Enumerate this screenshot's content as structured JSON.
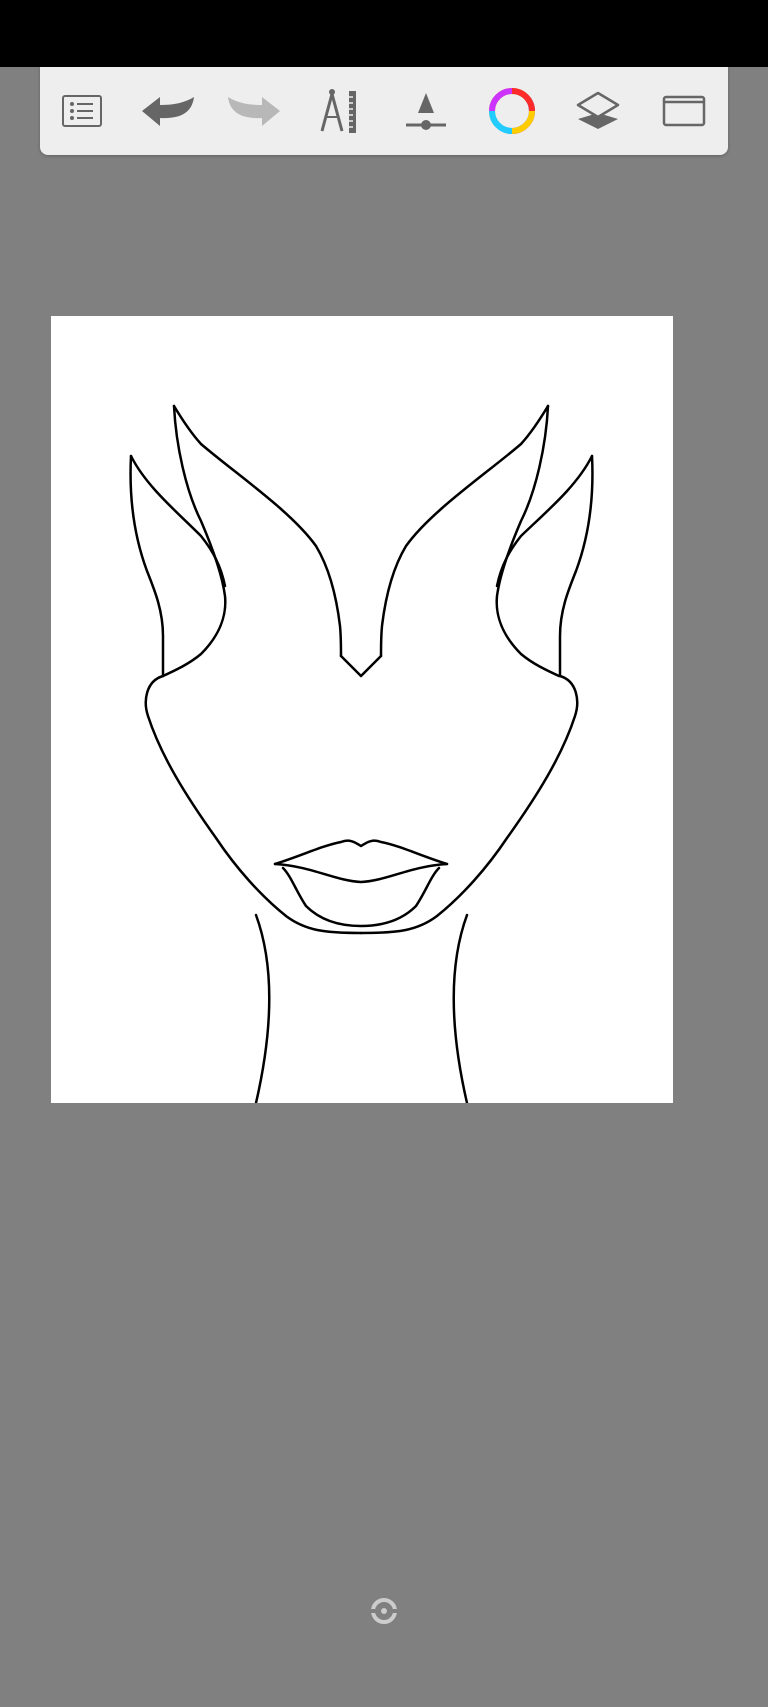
{
  "app": {
    "toolbar": {
      "tools": [
        {
          "name": "menu-button",
          "icon": "list-icon",
          "enabled": true
        },
        {
          "name": "undo-button",
          "icon": "undo-arrow-icon",
          "enabled": true
        },
        {
          "name": "redo-button",
          "icon": "redo-arrow-icon",
          "enabled": false
        },
        {
          "name": "ruler-button",
          "icon": "compass-ruler-icon",
          "enabled": true
        },
        {
          "name": "brush-button",
          "icon": "brush-cone-icon",
          "enabled": true
        },
        {
          "name": "color-button",
          "icon": "color-wheel-icon",
          "enabled": true
        },
        {
          "name": "layers-button",
          "icon": "layers-icon",
          "enabled": true
        },
        {
          "name": "fullscreen-button",
          "icon": "fullscreen-frame-icon",
          "enabled": true
        }
      ]
    },
    "canvas": {
      "background": "#ffffff",
      "stroke_color": "#000000",
      "drawing": "face-outline"
    },
    "colors": {
      "workspace": "#808080",
      "status_bar": "#000000",
      "toolbar": "#eeeeee",
      "icon_active": "#666666",
      "icon_disabled": "#b8b8b8"
    }
  }
}
